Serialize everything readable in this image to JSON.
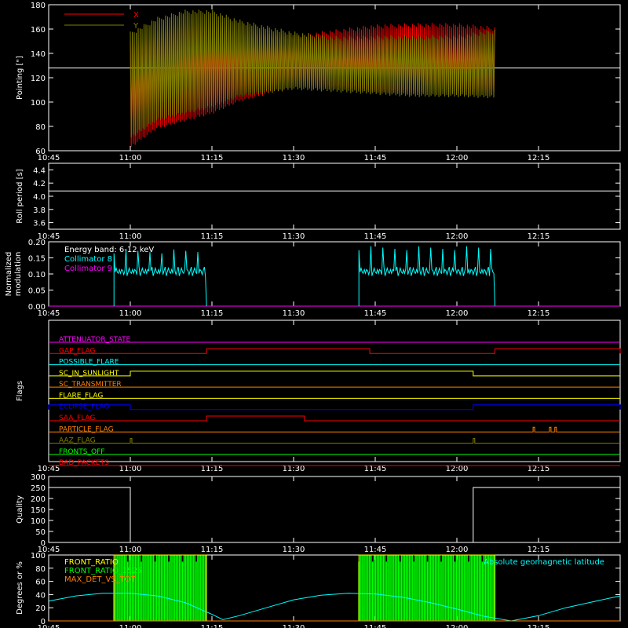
{
  "time_ticks": [
    "10:45",
    "11:00",
    "11:15",
    "11:30",
    "11:45",
    "12:00",
    "12:15"
  ],
  "colors": {
    "background": "#000000",
    "axis": "#ffffff",
    "x_pointing": "#ff0000",
    "y_pointing": "#808000",
    "cyan": "#00ffff",
    "magenta": "#ff00ff",
    "green": "#00ff00",
    "yellow": "#ffff00",
    "orange": "#ff8000"
  },
  "chart_data": [
    {
      "id": "pointing",
      "type": "line",
      "ylabel": "Pointing [\"]",
      "ylim": [
        60,
        180
      ],
      "yticks": [
        60,
        80,
        100,
        120,
        140,
        160,
        180
      ],
      "legend": [
        {
          "name": "X",
          "color": "#ff0000"
        },
        {
          "name": "Y",
          "color": "#808000"
        }
      ],
      "reference_line": 128,
      "data_start": "11:00",
      "data_end": "12:07",
      "series": [
        {
          "name": "X",
          "color": "#ff0000",
          "envelope_x": [
            "11:00",
            "11:05",
            "11:10",
            "11:15",
            "11:20",
            "11:30",
            "11:38",
            "11:45",
            "11:52",
            "12:00",
            "12:07"
          ],
          "max": [
            150,
            158,
            163,
            162,
            158,
            155,
            160,
            164,
            165,
            165,
            162
          ],
          "min": [
            62,
            78,
            84,
            90,
            100,
            112,
            112,
            108,
            107,
            106,
            105
          ]
        },
        {
          "name": "Y",
          "color": "#808000",
          "envelope_x": [
            "11:00",
            "11:05",
            "11:10",
            "11:15",
            "11:20",
            "11:30",
            "11:38",
            "11:45",
            "11:52",
            "12:00",
            "12:07"
          ],
          "max": [
            158,
            170,
            176,
            176,
            168,
            158,
            154,
            155,
            155,
            155,
            160
          ],
          "min": [
            70,
            84,
            90,
            95,
            104,
            110,
            108,
            106,
            104,
            104,
            103
          ]
        }
      ]
    },
    {
      "id": "roll_period",
      "type": "line",
      "ylabel": "Roll period [s]",
      "ylim": [
        3.5,
        4.5
      ],
      "yticks": [
        3.6,
        3.8,
        4.0,
        4.2,
        4.4
      ],
      "series": [
        {
          "name": "",
          "color": "#ffffff",
          "x": [
            "10:45",
            "12:30"
          ],
          "y": [
            4.08,
            4.08
          ]
        }
      ]
    },
    {
      "id": "modulation",
      "type": "line",
      "ylabel": "Normalized modulation",
      "ylim": [
        0,
        0.2
      ],
      "yticks": [
        0.0,
        0.05,
        0.1,
        0.15,
        0.2
      ],
      "legend_title": "Energy band: 6-12 keV",
      "legend": [
        {
          "name": "Collimator 8",
          "color": "#00ffff"
        },
        {
          "name": "Collimator 9",
          "color": "#ff00ff"
        }
      ],
      "segments": [
        {
          "start": "10:57",
          "end": "11:14",
          "level": 0.1,
          "max": 0.17
        },
        {
          "start": "11:42",
          "end": "12:07",
          "level": 0.1,
          "max": 0.18
        }
      ],
      "baseline": 0.0
    },
    {
      "id": "flags",
      "type": "line",
      "ylabel": "Flags",
      "flags": [
        {
          "name": "ATTENUATOR_STATE",
          "color": "#ff00ff",
          "transitions": []
        },
        {
          "name": "GAP_FLAG",
          "color": "#ff0000",
          "transitions": [
            [
              "11:14",
              "11:44"
            ],
            [
              "12:07",
              "12:30"
            ]
          ]
        },
        {
          "name": "POSSIBLE_FLARE",
          "color": "#00ffff",
          "transitions": []
        },
        {
          "name": "SC_IN_SUNLIGHT",
          "color": "#ffff00",
          "transitions": [
            [
              "11:00",
              "12:03"
            ]
          ]
        },
        {
          "name": "SC_TRANSMITTER",
          "color": "#ff8000",
          "transitions": []
        },
        {
          "name": "FLARE_FLAG",
          "color": "#ffff00",
          "transitions": []
        },
        {
          "name": "ECLIPSE_FLAG",
          "color": "#0000ff",
          "transitions": [
            [
              "10:45",
              "11:00"
            ],
            [
              "12:03",
              "12:30"
            ]
          ]
        },
        {
          "name": "SAA_FLAG",
          "color": "#ff0000",
          "transitions": [
            [
              "11:14",
              "11:32"
            ]
          ]
        },
        {
          "name": "PARTICLE_FLAG",
          "color": "#ff8000",
          "transitions": [
            [
              "12:14",
              "12:14"
            ],
            [
              "12:17",
              "12:17"
            ],
            [
              "12:18",
              "12:18"
            ]
          ]
        },
        {
          "name": "AAZ_FLAG",
          "color": "#808000",
          "transitions": [
            [
              "11:00",
              "11:00"
            ],
            [
              "12:03",
              "12:03"
            ]
          ]
        },
        {
          "name": "FRONTS_OFF",
          "color": "#00ff00",
          "transitions": []
        },
        {
          "name": "BAD_PACKETS",
          "color": "#ff0000",
          "transitions": []
        }
      ]
    },
    {
      "id": "quality",
      "type": "line",
      "ylabel": "Quality",
      "ylim": [
        0,
        300
      ],
      "yticks": [
        0,
        50,
        100,
        150,
        200,
        250,
        300
      ],
      "series": [
        {
          "name": "",
          "color": "#ffffff",
          "x": [
            "10:45",
            "11:00",
            "11:00",
            "12:03",
            "12:03",
            "12:30"
          ],
          "y": [
            250,
            250,
            0,
            0,
            250,
            250
          ]
        }
      ]
    },
    {
      "id": "ratios",
      "type": "line",
      "ylabel": "Degrees or %",
      "ylim": [
        0,
        100
      ],
      "yticks": [
        0,
        20,
        40,
        60,
        80,
        100
      ],
      "legend": [
        {
          "name": "FRONT_RATIO",
          "color": "#ffff00"
        },
        {
          "name": "FRONT_RATIO_1525",
          "color": "#00ff00"
        },
        {
          "name": "MAX_DET_VS_TOT",
          "color": "#ff8000"
        },
        {
          "name": "Absolute geomagnetic latitude",
          "color": "#00ffff"
        }
      ],
      "green_windows": [
        [
          "10:57",
          "11:14"
        ],
        [
          "11:42",
          "12:07"
        ]
      ],
      "latitude": {
        "x": [
          "10:45",
          "10:50",
          "10:55",
          "11:00",
          "11:05",
          "11:10",
          "11:15",
          "11:17",
          "11:20",
          "11:25",
          "11:30",
          "11:35",
          "11:40",
          "11:45",
          "11:50",
          "11:55",
          "12:00",
          "12:05",
          "12:10",
          "12:15",
          "12:20",
          "12:25",
          "12:30"
        ],
        "y": [
          30,
          38,
          42,
          42,
          38,
          28,
          10,
          2,
          8,
          20,
          32,
          39,
          42,
          41,
          36,
          28,
          18,
          7,
          0,
          8,
          20,
          29,
          38
        ]
      }
    }
  ]
}
